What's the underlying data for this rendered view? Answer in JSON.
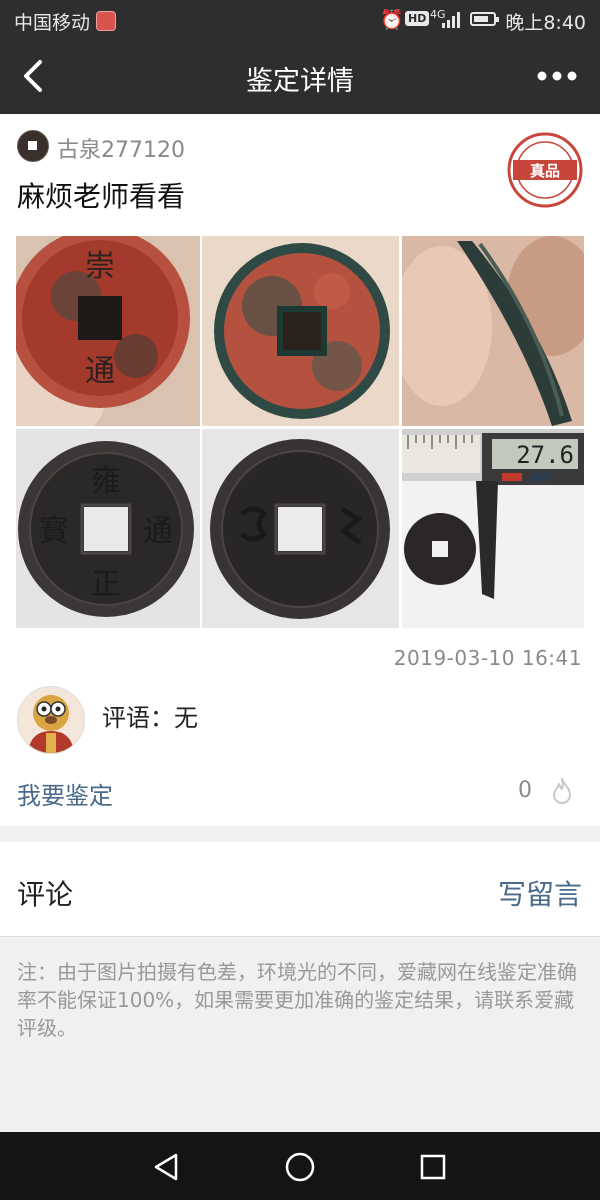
{
  "status_bar": {
    "carrier": "中国移动",
    "hd_badge": "HD",
    "network": "4G",
    "time": "晚上8:40"
  },
  "nav": {
    "title": "鉴定详情",
    "back_icon": "chevron-left-icon",
    "more_icon": "more-dots-icon"
  },
  "post": {
    "username": "古泉277120",
    "title": "麻烦老师看看",
    "seal_text": "真品",
    "timestamp": "2019-03-10  16:41"
  },
  "photos": [
    {
      "desc": "coin-obverse-red"
    },
    {
      "desc": "coin-reverse-red"
    },
    {
      "desc": "coin-edge"
    },
    {
      "desc": "coin-obverse-dark"
    },
    {
      "desc": "coin-reverse-dark"
    },
    {
      "desc": "coin-caliper"
    }
  ],
  "caliper_reading": "27.6",
  "review": {
    "comment": "评语：无"
  },
  "actions": {
    "appraise_label": "我要鉴定",
    "like_count": "0"
  },
  "comments": {
    "header": "评论",
    "write_label": "写留言"
  },
  "notice": "注：由于图片拍摄有色差，环境光的不同，爱藏网在线鉴定准确率不能保证100%，如果需要更加准确的鉴定结果，请联系爱藏评级。",
  "colors": {
    "bar_bg": "#2e2e2e",
    "link": "#4a6a8a",
    "muted": "#8a8a8a",
    "seal_red": "#c8453c"
  }
}
